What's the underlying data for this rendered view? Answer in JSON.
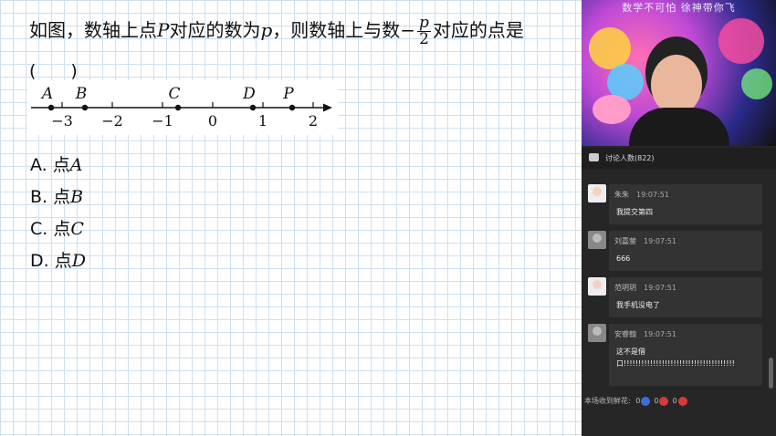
{
  "question": {
    "line1_prefix": "如图，数轴上点",
    "var_P": "P",
    "line1_mid": "对应的数为",
    "var_p": "p",
    "line1_mid2": "，则数轴上与数",
    "minus": "−",
    "frac_num": "p",
    "frac_den": "2",
    "line1_suffix": "对应的点是",
    "blank": "(　　)"
  },
  "number_line": {
    "points": [
      "A",
      "B",
      "C",
      "D",
      "P"
    ],
    "ticks": [
      "−3",
      "−2",
      "−1",
      "0",
      "1",
      "2"
    ]
  },
  "options": [
    {
      "prefix": "A. 点",
      "var": "A"
    },
    {
      "prefix": "B. 点",
      "var": "B"
    },
    {
      "prefix": "C. 点",
      "var": "C"
    },
    {
      "prefix": "D. 点",
      "var": "D"
    }
  ],
  "video": {
    "title": "数学不可怕 徐神带你飞"
  },
  "discussion": {
    "header": "讨论人数(822)",
    "messages": [
      {
        "name": "朱朱",
        "time": "19:07:51",
        "text": "我提交第四"
      },
      {
        "name": "刘嘉蓥",
        "time": "19:07:51",
        "text": "666"
      },
      {
        "name": "范明玥",
        "time": "19:07:51",
        "text": "我手机没电了"
      },
      {
        "name": "安睿翰",
        "time": "19:07:51",
        "text": "这不是借口!!!!!!!!!!!!!!!!!!!!!!!!!!!!!!!!!!!!!!"
      }
    ]
  },
  "footer": {
    "label": "本场收到鲜花:",
    "counts": [
      "0",
      "0",
      "0"
    ],
    "colors": [
      "#3a6fd8",
      "#d83a3a",
      "#d83a3a"
    ]
  }
}
